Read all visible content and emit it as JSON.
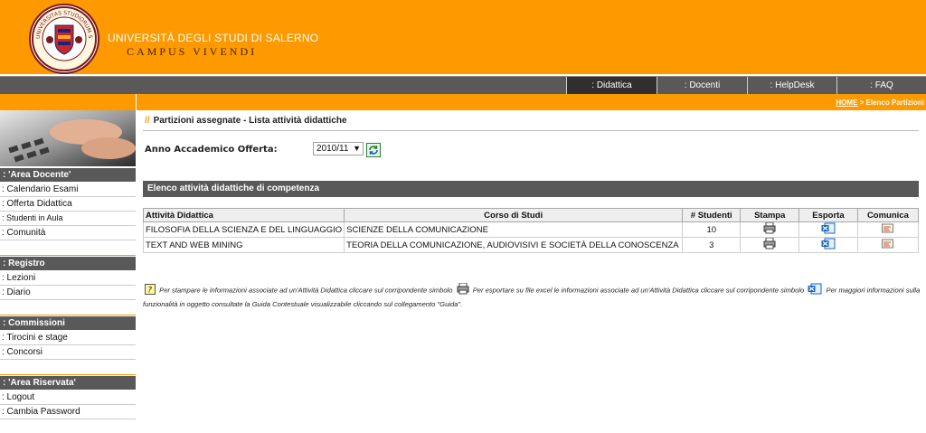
{
  "header": {
    "university_name": "UNIVERSITÀ DEGLI STUDI DI SALERNO",
    "subtitle": "CAMPUS VIVENDI",
    "seal_text": "UNIVERSITAS STUDIORUM SALERNI"
  },
  "topnav": {
    "items": [
      {
        "label": ": Didattica",
        "active": true
      },
      {
        "label": ": Docenti",
        "active": false
      },
      {
        "label": ": HelpDesk",
        "active": false
      },
      {
        "label": ": FAQ",
        "active": false
      }
    ]
  },
  "breadcrumb": {
    "home": "HOME",
    "separator": " > ",
    "current": "Elenco Partizioni"
  },
  "sidebar": {
    "sections": [
      {
        "header": ": 'Area Docente'",
        "items": [
          ": Calendario Esami",
          ": Offerta Didattica",
          ": Studenti in Aula",
          ": Comunità"
        ]
      },
      {
        "header": ": Registro",
        "items": [
          ": Lezioni",
          ": Diario"
        ]
      },
      {
        "header": ": Commissioni",
        "items": [
          ": Tirocini e stage",
          ": Concorsi"
        ]
      },
      {
        "header": ": 'Area Riservata'",
        "items": [
          ": Logout",
          ": Cambia Password"
        ]
      }
    ]
  },
  "main": {
    "title_prefix": "//",
    "title": "Partizioni assegnate - Lista attività didattiche",
    "year_label": "Anno Accademico Offerta:",
    "year_value": "2010/11",
    "section_title": "Elenco attività didattiche di competenza",
    "table": {
      "columns": [
        "Attività Didattica",
        "Corso di Studi",
        "# Studenti",
        "Stampa",
        "Esporta",
        "Comunica"
      ],
      "rows": [
        {
          "activity": "FILOSOFIA DELLA SCIENZA E DEL LINGUAGGIO",
          "course": "SCIENZE DELLA COMUNICAZIONE",
          "students": "10"
        },
        {
          "activity": "TEXT AND WEB MINING",
          "course": "TEORIA DELLA COMUNICAZIONE, AUDIOVISIVI E SOCIETÀ DELLA CONOSCENZA",
          "students": "3"
        }
      ]
    },
    "help_note": {
      "part1": "Per stampare le informazioni associate ad un'Attività Didattica cliccare sul corripondente simbolo",
      "part2": "Per esportare su file excel le informazioni associate ad un'Attività Didattica cliccare sul corripondente simbolo",
      "part3": "Per maggiori informazioni sulla funzionalità in oggetto consultate la Guida Contestuale visualizzabile cliccando sul collegamento \"Guida\"."
    }
  },
  "colors": {
    "brand_orange": "#ff9900",
    "nav_gray": "#595959",
    "nav_active": "#2f2f2f",
    "seal_red": "#7a1b1b"
  }
}
